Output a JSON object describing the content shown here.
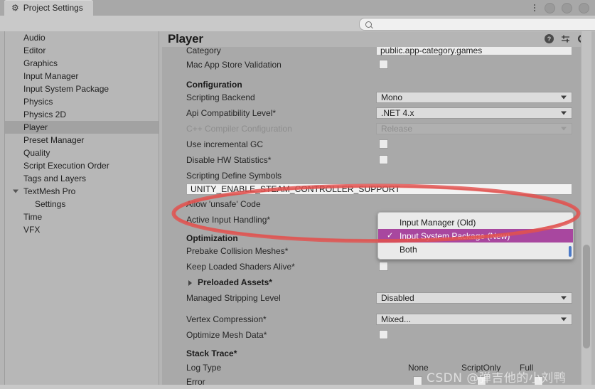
{
  "window": {
    "tab_label": "Project Settings",
    "tab_icon": "gear-icon",
    "menu_icon": "kebab-menu-icon",
    "buttons": [
      "minimize",
      "maximize",
      "close"
    ]
  },
  "search": {
    "value": "",
    "placeholder": "",
    "icon": "search-icon"
  },
  "sidebar": {
    "items": [
      {
        "label": "Audio",
        "selected": false,
        "child": false
      },
      {
        "label": "Editor",
        "selected": false,
        "child": false
      },
      {
        "label": "Graphics",
        "selected": false,
        "child": false
      },
      {
        "label": "Input Manager",
        "selected": false,
        "child": false
      },
      {
        "label": "Input System Package",
        "selected": false,
        "child": false
      },
      {
        "label": "Physics",
        "selected": false,
        "child": false
      },
      {
        "label": "Physics 2D",
        "selected": false,
        "child": false
      },
      {
        "label": "Player",
        "selected": true,
        "child": false
      },
      {
        "label": "Preset Manager",
        "selected": false,
        "child": false
      },
      {
        "label": "Quality",
        "selected": false,
        "child": false
      },
      {
        "label": "Script Execution Order",
        "selected": false,
        "child": false
      },
      {
        "label": "Tags and Layers",
        "selected": false,
        "child": false
      },
      {
        "label": "TextMesh Pro",
        "selected": false,
        "child": false,
        "expanded": true
      },
      {
        "label": "Settings",
        "selected": false,
        "child": true
      },
      {
        "label": "Time",
        "selected": false,
        "child": false
      },
      {
        "label": "VFX",
        "selected": false,
        "child": false
      }
    ]
  },
  "main": {
    "title": "Player",
    "header_icons": [
      "help-icon",
      "preset-icon",
      "gear-icon"
    ],
    "rows": {
      "category_label": "Category",
      "category_value": "public.app-category.games",
      "mac_validation_label": "Mac App Store Validation",
      "configuration_header": "Configuration",
      "scripting_backend_label": "Scripting Backend",
      "scripting_backend_value": "Mono",
      "api_compat_label": "Api Compatibility Level*",
      "api_compat_value": ".NET 4.x",
      "cpp_compiler_label": "C++ Compiler Configuration",
      "cpp_compiler_value": "Release",
      "incremental_gc_label": "Use incremental GC",
      "disable_hw_stats_label": "Disable HW Statistics*",
      "define_symbols_label": "Scripting Define Symbols",
      "define_symbols_value": "UNITY_ENABLE_STEAM_CONTROLLER_SUPPORT",
      "unsafe_code_label": "Allow 'unsafe' Code",
      "active_input_label": "Active Input Handling*",
      "optimization_header": "Optimization",
      "prebake_label": "Prebake Collision Meshes*",
      "keep_shaders_label": "Keep Loaded Shaders Alive*",
      "preloaded_assets_label": "Preloaded Assets*",
      "stripping_label": "Managed Stripping Level",
      "stripping_value": "Disabled",
      "vertex_compression_label": "Vertex Compression*",
      "vertex_compression_value": "Mixed...",
      "optimize_mesh_label": "Optimize Mesh Data*",
      "stack_trace_header": "Stack Trace*",
      "log_type_label": "Log Type",
      "col_none": "None",
      "col_scriptonly": "ScriptOnly",
      "col_full": "Full",
      "error_label": "Error"
    }
  },
  "dropdown": {
    "options": [
      {
        "label": "Input Manager (Old)",
        "selected": false
      },
      {
        "label": "Input System Package (New)",
        "selected": true
      },
      {
        "label": "Both",
        "selected": false
      }
    ],
    "check_glyph": "✓",
    "highlight_color": "#a8479f"
  },
  "annotation": {
    "shape": "ellipse",
    "color": "#e2514e"
  },
  "watermark": {
    "text": "CSDN @弹吉他的小刘鸭"
  }
}
